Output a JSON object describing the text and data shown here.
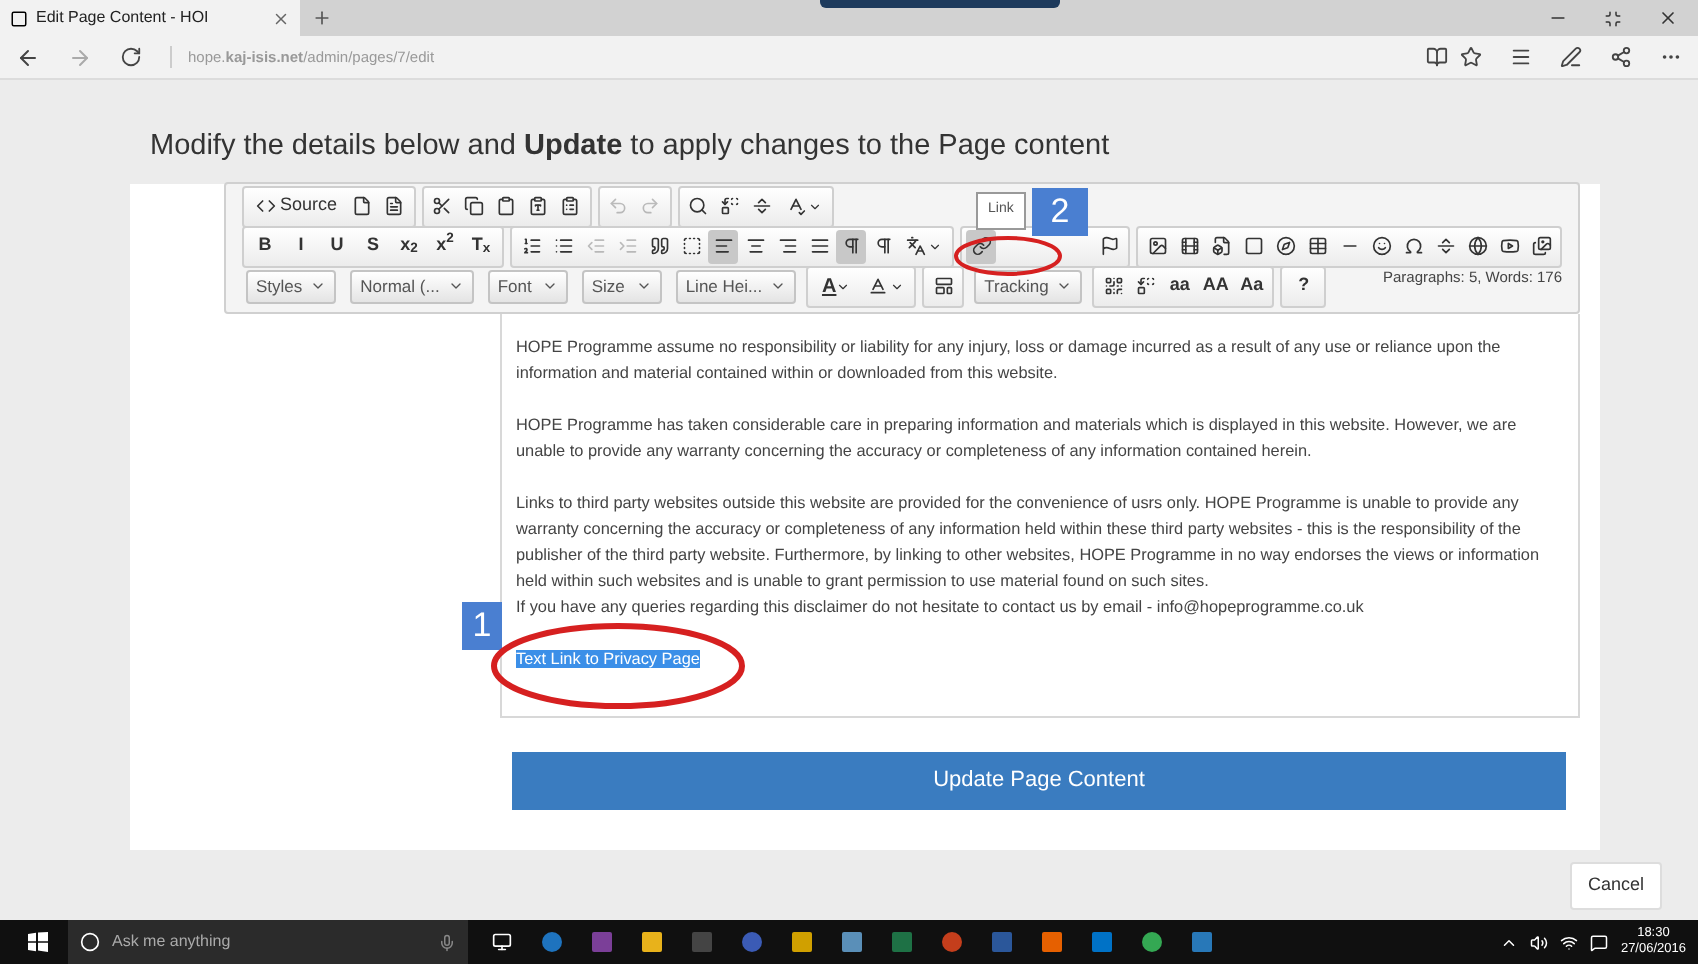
{
  "browser": {
    "tab_title": "Edit Page Content - HOI",
    "url": "hope.**kaj-isis.net**/admin/pages/7/edit"
  },
  "page": {
    "instruction": "Modify the details below and **Update** to apply changes to the Page content"
  },
  "editor": {
    "toolbar": {
      "rows": [
        [
          [
            {
              "kind": "labeled",
              "label": "Source",
              "on": false
            },
            {
              "kind": "icon",
              "on": false
            },
            {
              "kind": "icon",
              "on": false
            }
          ],
          [
            {
              "kind": "icon",
              "on": false
            },
            {
              "kind": "icon",
              "on": false
            },
            {
              "kind": "icon",
              "on": false
            },
            {
              "kind": "icon",
              "on": false
            },
            {
              "kind": "icon",
              "on": false
            }
          ],
          [
            {
              "kind": "disabled",
              "on": false
            },
            {
              "kind": "disabled",
              "on": false
            }
          ],
          [
            {
              "kind": "icon",
              "on": false
            },
            {
              "kind": "icon",
              "on": false
            },
            {
              "kind": "icon",
              "on": false
            },
            {
              "kind": "icon_menu",
              "on": false
            }
          ]
        ],
        [
          [
            {
              "kind": "text",
              "label": "B",
              "on": false
            },
            {
              "kind": "text",
              "label": "I",
              "on": false
            },
            {
              "kind": "text",
              "label": "U",
              "on": false
            },
            {
              "kind": "text",
              "label": "S",
              "on": false
            },
            {
              "kind": "text",
              "label": "x$_{2}$",
              "on": false
            },
            {
              "kind": "text",
              "label": "x$^{2}$",
              "on": false
            },
            {
              "kind": "text",
              "label": "T$_{x}$",
              "on": false
            }
          ],
          [
            {
              "kind": "icon",
              "on": false
            },
            {
              "kind": "icon",
              "on": false
            },
            {
              "kind": "disabled",
              "on": false
            },
            {
              "kind": "disabled",
              "on": false
            },
            {
              "kind": "icon",
              "on": false
            },
            {
              "kind": "icon",
              "on": false
            },
            {
              "kind": "icon",
              "on": true
            },
            {
              "kind": "icon",
              "on": false
            },
            {
              "kind": "icon",
              "on": false
            },
            {
              "kind": "icon",
              "on": false
            },
            {
              "kind": "icon",
              "on": true
            },
            {
              "kind": "icon",
              "on": false
            },
            {
              "kind": "icon_menu",
              "on": false
            }
          ],
          [
            {
              "kind": "icon",
              "on": true
            },
            {
              "kind": "icon_far",
              "on": false
            }
          ],
          [
            {
              "kind": "icon",
              "on": false
            },
            {
              "kind": "icon",
              "on": false
            },
            {
              "kind": "icon",
              "on": false
            },
            {
              "kind": "icon",
              "on": false
            },
            {
              "kind": "icon",
              "on": false
            },
            {
              "kind": "icon",
              "on": false
            },
            {
              "kind": "icon",
              "on": false
            },
            {
              "kind": "icon",
              "on": false
            },
            {
              "kind": "icon",
              "on": false
            },
            {
              "kind": "icon",
              "on": false
            },
            {
              "kind": "icon",
              "on": false
            },
            {
              "kind": "icon",
              "on": false
            },
            {
              "kind": "icon",
              "on": false
            }
          ]
        ],
        [
          [
            {
              "kind": "dropdown",
              "label": "Styles"
            }
          ],
          [
            {
              "kind": "dropdown",
              "label": "Normal (..."
            }
          ],
          [
            {
              "kind": "dropdown",
              "label": "Font"
            }
          ],
          [
            {
              "kind": "dropdown",
              "label": "Size"
            }
          ],
          [
            {
              "kind": "dropdown",
              "label": "Line Hei..."
            }
          ],
          [
            {
              "kind": "text_menu",
              "label": "A",
              "on": false
            },
            {
              "kind": "icon_menu",
              "on": false
            }
          ],
          [
            {
              "kind": "icon",
              "on": false
            }
          ],
          [
            {
              "kind": "dropdown",
              "label": "Tracking"
            }
          ],
          [
            {
              "kind": "icon",
              "on": false
            },
            {
              "kind": "icon",
              "on": false
            },
            {
              "kind": "text",
              "label": "aa",
              "on": false
            },
            {
              "kind": "text",
              "label": "AA",
              "on": false
            },
            {
              "kind": "text",
              "label": "Aa",
              "on": false
            }
          ],
          [
            {
              "kind": "text",
              "label": "?",
              "on": false
            }
          ]
        ]
      ]
    },
    "tooltip": "Link",
    "word_count": "Paragraphs: 5, Words: 176",
    "paragraphs": [
      {
        "lines": [
          "HOPE Programme assume no responsibility or liability for any injury, loss or damage incurred as a result of any use or reliance upon the information and material contained within or downloaded from this website."
        ]
      },
      {
        "lines": [
          "HOPE Programme has taken considerable care in preparing information and materials which is displayed in this website. However, we are unable to provide any warranty concerning the accuracy or completeness of any information contained herein."
        ]
      },
      {
        "lines": [
          "Links to third party websites outside this website are provided for the convenience of usrs only. HOPE Programme is unable to provide any warranty concerning the accuracy or completeness of any information held within these third party websites - this is the responsibility of the publisher of the third party website. Furthermore, by linking to other websites, HOPE Programme in no way endorses the views or information held within such websites and is unable to grant permission to use material found on such sites.",
          "If you have any queries regarding this disclaimer do not hesitate to contact us by email - info@hopeprogramme.co.uk"
        ]
      }
    ],
    "link": {
      "text": "Text Link to Privacy Page",
      "selected": true
    }
  },
  "update_button": "Update Page Content",
  "cancel_button": "Cancel",
  "annotations": [
    {
      "number": "1"
    },
    {
      "number": "2"
    }
  ],
  "taskbar": {
    "search_placeholder": "Ask me anything",
    "time": "18:30",
    "date": "27/06/2016"
  }
}
